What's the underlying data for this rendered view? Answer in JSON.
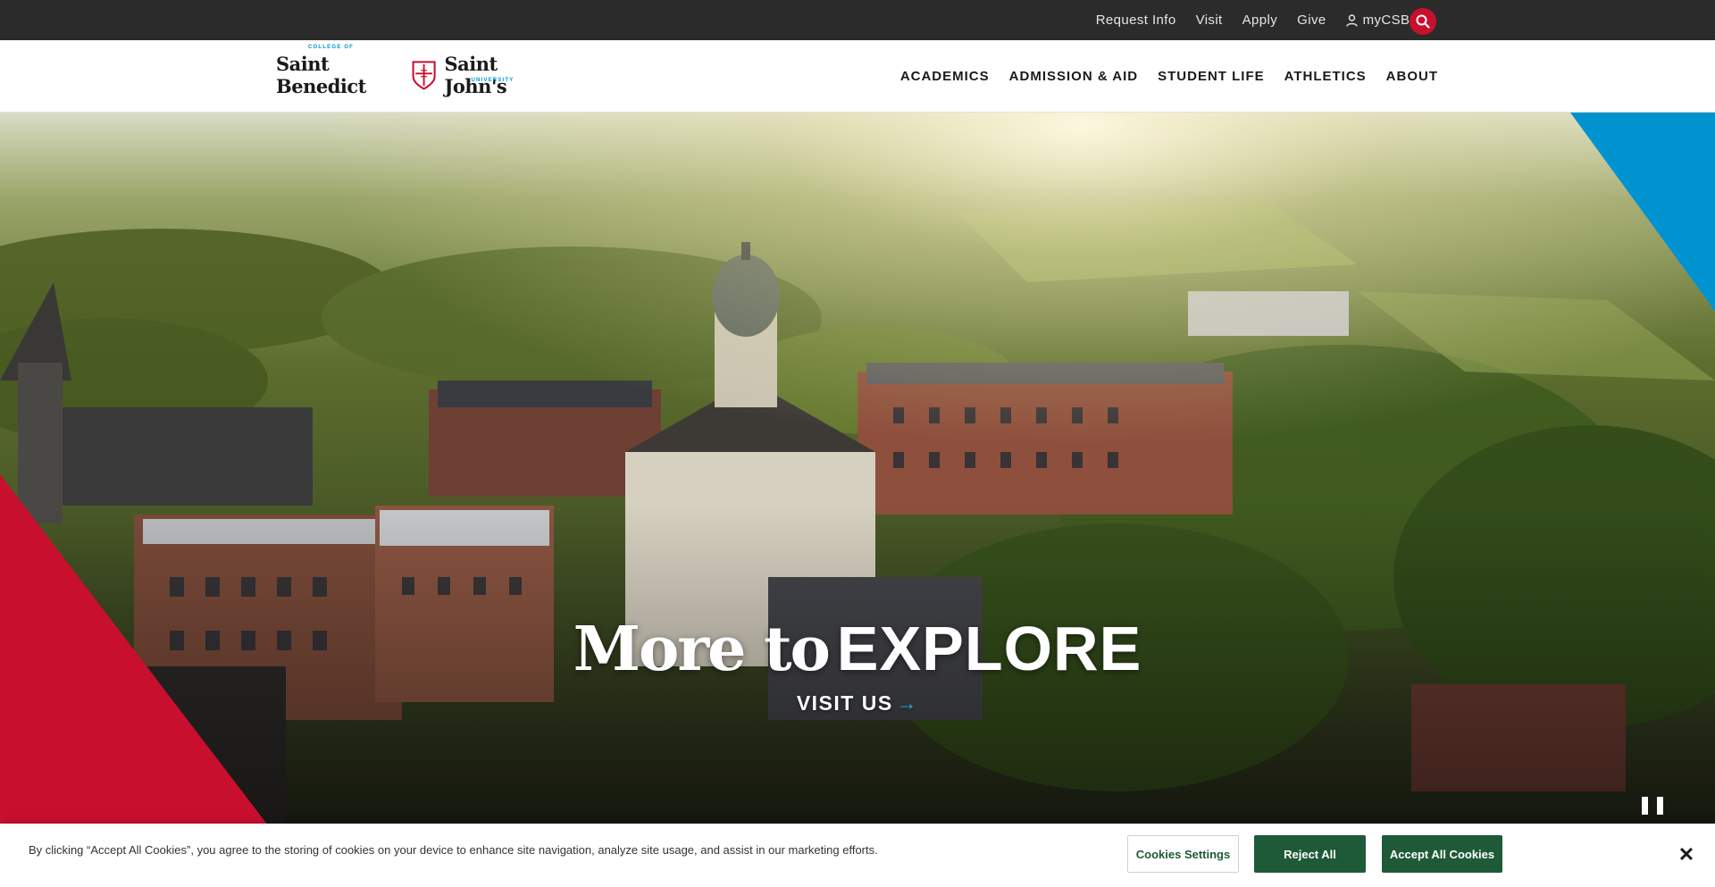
{
  "utility_nav": {
    "links": [
      "Request Info",
      "Visit",
      "Apply",
      "Give"
    ],
    "account_label": "myCSBSJU"
  },
  "logo": {
    "college_of": "COLLEGE OF",
    "left_name": "Saint Benedict",
    "right_name": "Saint John's",
    "university": "UNIVERSITY"
  },
  "main_nav": [
    "ACADEMICS",
    "ADMISSION & AID",
    "STUDENT LIFE",
    "ATHLETICS",
    "ABOUT"
  ],
  "hero": {
    "title_serif": "More to",
    "title_sans": "EXPLORE",
    "cta_label": "VISIT US",
    "cta_arrow": "→"
  },
  "cookie_banner": {
    "text": "By clicking “Accept All Cookies”, you agree to the storing of cookies on your device to enhance site navigation, analyze site usage, and assist in our marketing efforts.",
    "settings_label": "Cookies Settings",
    "reject_label": "Reject All",
    "accept_label": "Accept All Cookies",
    "close_glyph": "✕"
  },
  "icons": {
    "search": "search-icon",
    "user": "user-icon",
    "pause": "pause-icon",
    "close": "close-icon",
    "shield": "shield-icon"
  },
  "colors": {
    "brand_red": "#c8102e",
    "brand_blue": "#0093d0",
    "utility_bar": "#2b2b2b",
    "cookie_green": "#1f5a38"
  }
}
